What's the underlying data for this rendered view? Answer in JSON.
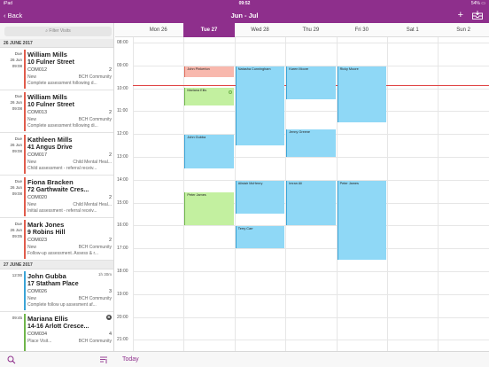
{
  "status": {
    "carrier": "iPad",
    "time": "09:52",
    "battery": "54%"
  },
  "nav": {
    "back": "Back",
    "title": "Jun - Jul",
    "add": "+"
  },
  "sidebar": {
    "filter_placeholder": "Filter Visits",
    "groups": [
      {
        "date": "26 JUNE 2017",
        "visits": [
          {
            "due": "Due",
            "date": "26 Jun",
            "time": "09:08",
            "name": "William Mills",
            "address": "10 Fulner Street",
            "code": "COM012",
            "count": "2",
            "status": "New",
            "team": "BCH Community",
            "desc": "Complete assessment following d...",
            "bar": "#e05c4c"
          },
          {
            "due": "Due",
            "date": "26 Jun",
            "time": "09:08",
            "name": "William Mills",
            "address": "10 Fulner Street",
            "code": "COM013",
            "count": "2",
            "status": "New",
            "team": "BCH Community",
            "desc": "Complete assessment following di...",
            "bar": "#e05c4c"
          },
          {
            "due": "Due",
            "date": "26 Jun",
            "time": "09:08",
            "name": "Kathleen Mills",
            "address": "41 Angus Drive",
            "code": "COM017",
            "count": "2",
            "status": "New",
            "team": "Child Mental Heal...",
            "desc": "Child assessment - referral receiv...",
            "bar": "#e05c4c"
          },
          {
            "due": "Due",
            "date": "26 Jun",
            "time": "09:08",
            "name": "Fiona Bracken",
            "address": "72 Garthwaite Cres...",
            "code": "COM020",
            "count": "2",
            "status": "New",
            "team": "Child Mental Heal...",
            "desc": "Initial assessment - referral receiv...",
            "bar": "#e05c4c"
          },
          {
            "due": "Due",
            "date": "26 Jun",
            "time": "09:05",
            "name": "Mark Jones",
            "address": "9 Robins Hill",
            "code": "COM023",
            "count": "2",
            "status": "New",
            "team": "BCH Community",
            "desc": "Follow-up assessment. Assess & r...",
            "bar": "#e05c4c"
          }
        ]
      },
      {
        "date": "27 JUNE 2017",
        "visits": [
          {
            "due": "",
            "date": "",
            "time": "12:00",
            "duration": "1h 30m",
            "name": "John Gubba",
            "address": "17 Statham Place",
            "code": "COM026",
            "count": "3",
            "status": "New",
            "team": "BCH Community",
            "desc": "Complete follow up assesment af...",
            "bar": "#3aa3d6"
          },
          {
            "due": "",
            "date": "",
            "time": "09:45",
            "badge": "B",
            "name": "Mariana Ellis",
            "address": "14-16 Arlott Cresce...",
            "code": "COM034",
            "count": "4",
            "status": "Place Visit...",
            "team": "BCH Community",
            "desc": "",
            "bar": "#6fb54a"
          }
        ]
      }
    ]
  },
  "calendar": {
    "days": [
      "Mon 26",
      "Tue 27",
      "Wed 28",
      "Thu 29",
      "Fri 30",
      "Sat 1",
      "Sun 2"
    ],
    "selected_day": "Tue 27",
    "hours": [
      "08:00",
      "09:00",
      "10:00",
      "11:00",
      "12:00",
      "13:00",
      "14:00",
      "15:00",
      "16:00",
      "17:00",
      "18:00",
      "19:00",
      "20:00",
      "21:00"
    ],
    "now_time": "09:52",
    "events": [
      {
        "name": "John Pinkerton",
        "day": 1,
        "start": 9.0,
        "end": 9.5,
        "color": "pink"
      },
      {
        "name": "Mariana Ellis",
        "day": 1,
        "start": 9.95,
        "end": 10.75,
        "color": "green",
        "dot": true
      },
      {
        "name": "John Gubba",
        "day": 1,
        "start": 12.0,
        "end": 13.5,
        "color": "blue"
      },
      {
        "name": "Peter James",
        "day": 1,
        "start": 14.5,
        "end": 16.0,
        "color": "green"
      },
      {
        "name": "Natasha Cunningham",
        "day": 2,
        "start": 9.0,
        "end": 12.5,
        "color": "blue"
      },
      {
        "name": "Karen Moore",
        "day": 3,
        "start": 9.0,
        "end": 10.5,
        "color": "blue"
      },
      {
        "name": "Jenny Greene",
        "day": 3,
        "start": 11.75,
        "end": 13.0,
        "color": "blue"
      },
      {
        "name": "Ricky Moore",
        "day": 4,
        "start": 9.0,
        "end": 11.5,
        "color": "blue"
      },
      {
        "name": "Alistair McHenry",
        "day": 2,
        "start": 14.0,
        "end": 15.5,
        "color": "blue"
      },
      {
        "name": "Terry Carr",
        "day": 2,
        "start": 16.0,
        "end": 17.0,
        "color": "blue"
      },
      {
        "name": "Imran Ali",
        "day": 3,
        "start": 14.0,
        "end": 16.0,
        "color": "blue"
      },
      {
        "name": "Peter James",
        "day": 4,
        "start": 14.0,
        "end": 17.5,
        "color": "blue"
      }
    ]
  },
  "bottom": {
    "today": "Today"
  }
}
